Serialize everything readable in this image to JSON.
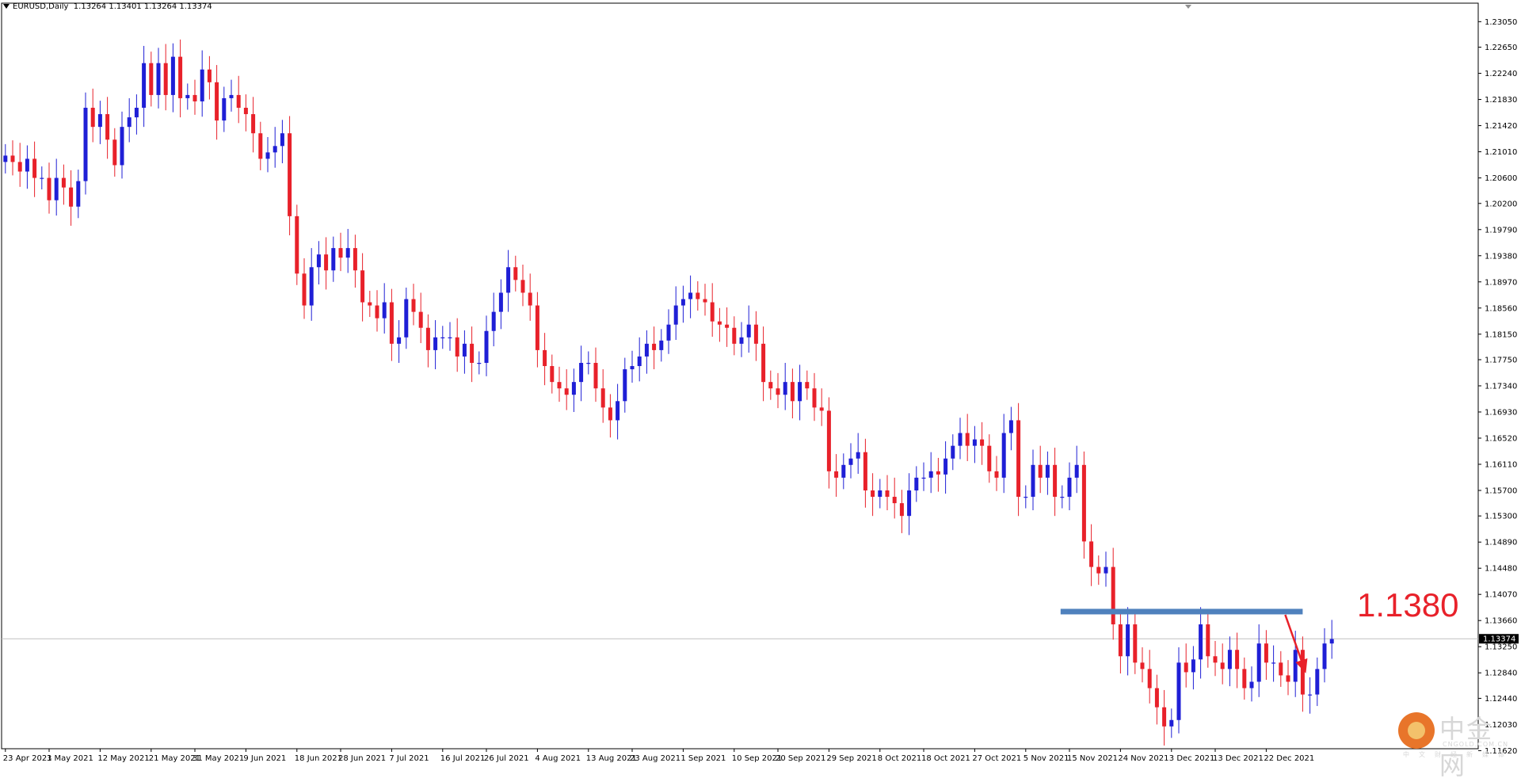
{
  "header": {
    "symbol": "EURUSD,Daily",
    "ohlc": "1.13264 1.13401 1.13264 1.13374"
  },
  "annotation": {
    "level_label": "1.1380"
  },
  "watermark": {
    "cn": "中金网",
    "en": "CNGOLD.COM.CN",
    "sub": "中文财经新媒体"
  },
  "colors": {
    "bull": "#1f1fd6",
    "bear": "#e8212a",
    "level_line": "#4f81bd",
    "arrow": "#e8212a",
    "background": "#ffffff"
  },
  "chart_data": {
    "type": "candlestick",
    "symbol": "EURUSD",
    "timeframe": "Daily",
    "ylim": [
      1.1165,
      1.2334
    ],
    "y_ticks": [
      "1.23050",
      "1.22650",
      "1.22240",
      "1.21830",
      "1.21420",
      "1.21010",
      "1.20600",
      "1.20200",
      "1.19790",
      "1.19380",
      "1.18970",
      "1.18560",
      "1.18150",
      "1.17750",
      "1.17340",
      "1.16930",
      "1.16520",
      "1.16110",
      "1.15700",
      "1.15300",
      "1.14890",
      "1.14480",
      "1.14070",
      "1.13660",
      "1.13250",
      "1.12840",
      "1.12440",
      "1.12030",
      "1.11620"
    ],
    "x_ticks": [
      {
        "label": "23 Apr 2021",
        "index": 0
      },
      {
        "label": "3 May 2021",
        "index": 6
      },
      {
        "label": "12 May 2021",
        "index": 13
      },
      {
        "label": "21 May 2021",
        "index": 20
      },
      {
        "label": "31 May 2021",
        "index": 26
      },
      {
        "label": "9 Jun 2021",
        "index": 33
      },
      {
        "label": "18 Jun 2021",
        "index": 40
      },
      {
        "label": "28 Jun 2021",
        "index": 46
      },
      {
        "label": "7 Jul 2021",
        "index": 53
      },
      {
        "label": "16 Jul 2021",
        "index": 60
      },
      {
        "label": "26 Jul 2021",
        "index": 66
      },
      {
        "label": "4 Aug 2021",
        "index": 73
      },
      {
        "label": "13 Aug 2021",
        "index": 80
      },
      {
        "label": "23 Aug 2021",
        "index": 86
      },
      {
        "label": "1 Sep 2021",
        "index": 93
      },
      {
        "label": "10 Sep 2021",
        "index": 100
      },
      {
        "label": "20 Sep 2021",
        "index": 106
      },
      {
        "label": "29 Sep 2021",
        "index": 113
      },
      {
        "label": "8 Oct 2021",
        "index": 120
      },
      {
        "label": "18 Oct 2021",
        "index": 126
      },
      {
        "label": "27 Oct 2021",
        "index": 133
      },
      {
        "label": "5 Nov 2021",
        "index": 140
      },
      {
        "label": "15 Nov 2021",
        "index": 146
      },
      {
        "label": "24 Nov 2021",
        "index": 153
      },
      {
        "label": "3 Dec 2021",
        "index": 160
      },
      {
        "label": "13 Dec 2021",
        "index": 166
      },
      {
        "label": "22 Dec 2021",
        "index": 173
      }
    ],
    "current_price": 1.13374,
    "current_price_label": "1.13374",
    "resistance_level": 1.138,
    "resistance_from_index": 145,
    "resistance_to_index": 178,
    "closes": [
      1.2095,
      1.2085,
      1.207,
      1.209,
      1.206,
      1.206,
      1.2025,
      1.206,
      1.2045,
      1.2015,
      1.2055,
      1.217,
      1.214,
      1.216,
      1.212,
      1.208,
      1.214,
      1.2155,
      1.217,
      1.224,
      1.219,
      1.224,
      1.219,
      1.225,
      1.2185,
      1.219,
      1.218,
      1.223,
      1.221,
      1.215,
      1.2185,
      1.219,
      1.217,
      1.216,
      1.213,
      1.209,
      1.21,
      1.211,
      1.213,
      1.2,
      1.191,
      1.186,
      1.192,
      1.194,
      1.1915,
      1.195,
      1.1935,
      1.195,
      1.1915,
      1.1865,
      1.186,
      1.184,
      1.1865,
      1.18,
      1.181,
      1.187,
      1.185,
      1.1825,
      1.179,
      1.181,
      1.181,
      1.181,
      1.178,
      1.18,
      1.177,
      1.177,
      1.182,
      1.185,
      1.188,
      1.192,
      1.19,
      1.188,
      1.186,
      1.179,
      1.1765,
      1.174,
      1.173,
      1.172,
      1.174,
      1.177,
      1.177,
      1.173,
      1.17,
      1.168,
      1.171,
      1.176,
      1.1765,
      1.178,
      1.18,
      1.179,
      1.1805,
      1.183,
      1.186,
      1.187,
      1.188,
      1.187,
      1.1865,
      1.1835,
      1.183,
      1.1825,
      1.18,
      1.181,
      1.183,
      1.18,
      1.174,
      1.173,
      1.172,
      1.174,
      1.171,
      1.174,
      1.173,
      1.17,
      1.1695,
      1.16,
      1.159,
      1.161,
      1.162,
      1.163,
      1.157,
      1.156,
      1.157,
      1.156,
      1.155,
      1.153,
      1.157,
      1.159,
      1.159,
      1.16,
      1.1595,
      1.162,
      1.164,
      1.166,
      1.164,
      1.165,
      1.164,
      1.16,
      1.159,
      1.166,
      1.168,
      1.156,
      1.156,
      1.161,
      1.159,
      1.161,
      1.156,
      1.156,
      1.159,
      1.161,
      1.149,
      1.145,
      1.144,
      1.145,
      1.136,
      1.131,
      1.136,
      1.13,
      1.129,
      1.126,
      1.123,
      1.12,
      1.121,
      1.13,
      1.1285,
      1.1305,
      1.136,
      1.131,
      1.13,
      1.129,
      1.132,
      1.129,
      1.126,
      1.127,
      1.133,
      1.13,
      1.13,
      1.128,
      1.127,
      1.132,
      1.125,
      1.125,
      1.129,
      1.133,
      1.1337
    ]
  }
}
